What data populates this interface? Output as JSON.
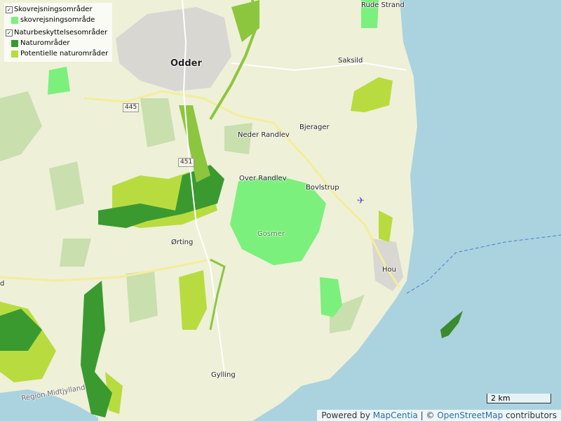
{
  "legend": {
    "group1_label": "Skovrejsningsområder",
    "group1_item": "skovrejsningsområde",
    "group2_label": "Naturbeskyttelsesområder",
    "group2_item1": "Naturområder",
    "group2_item2": "Potentielle naturområder",
    "colors": {
      "skovrejsning": "#7cf07c",
      "natur": "#3a9a30",
      "potentiel": "#b8dc40"
    }
  },
  "places": {
    "odder": "Odder",
    "rude_strand": "Rude Strand",
    "saksild": "Saksild",
    "bjerager": "Bjerager",
    "neder_randlev": "Neder Randlev",
    "over_randlev": "Over Randlev",
    "bovlstrup": "Bovlstrup",
    "gosmer": "Gosmer",
    "orting": "Ørting",
    "hou": "Hou",
    "gylling": "Gylling",
    "region": "Region Midtjylland",
    "edge_d": "d"
  },
  "roads": {
    "r445": "445",
    "r451": "451"
  },
  "scale_label": "2 km",
  "attribution": {
    "prefix": "Powered by ",
    "mapcentia": "MapCentia",
    "sep": " | © ",
    "osm": "OpenStreetMap",
    "suffix": " contributors"
  },
  "icons": {
    "airport": "airplane-icon"
  }
}
